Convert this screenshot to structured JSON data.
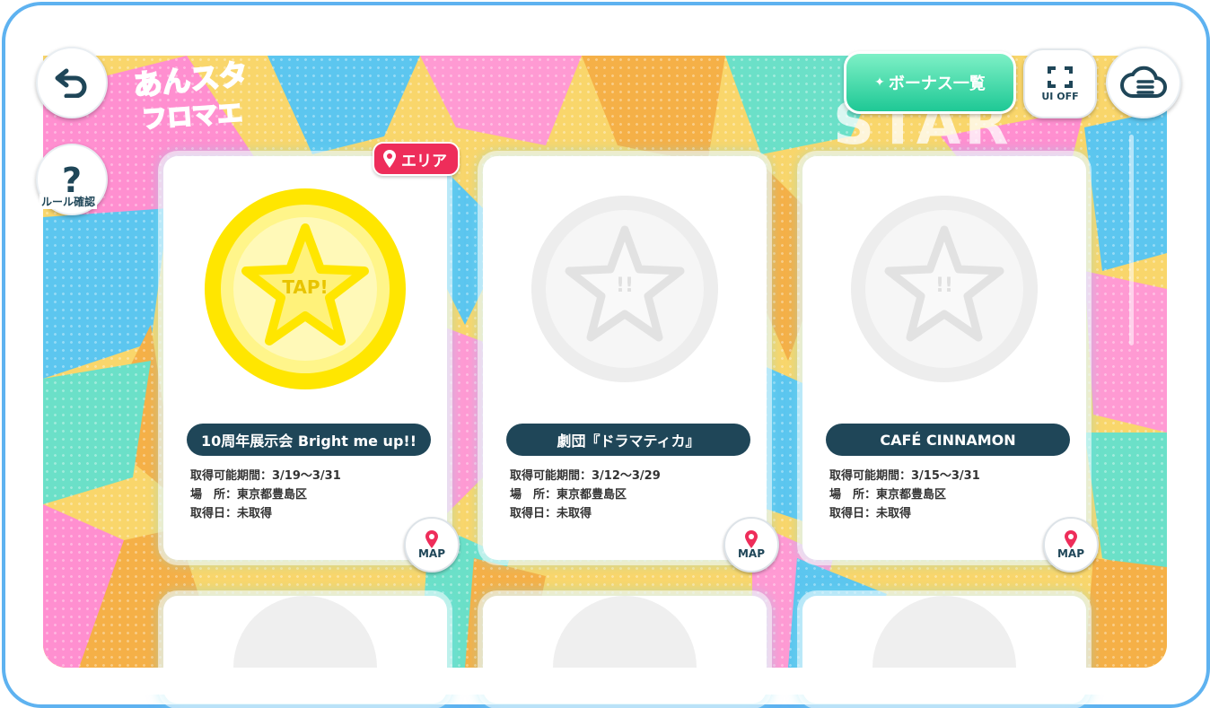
{
  "header": {
    "logo_text_line1": "あんスタ",
    "logo_text_line2": "フロマエ",
    "bonus_button_label": "ボーナス一覧",
    "ui_off_label": "UI OFF",
    "help_label": "ルール確認"
  },
  "background": {
    "word": "STAR"
  },
  "cards": [
    {
      "title": "10周年展示会 Bright me up!!",
      "period": "取得可能期間：3/19〜3/31",
      "place": "場　所：東京都豊島区",
      "acquired": "取得日：未取得",
      "badge": "エリア",
      "medal_text": "TAP!",
      "active": true,
      "map_label": "MAP"
    },
    {
      "title": "劇団『ドラマティカ』",
      "period": "取得可能期間：3/12〜3/29",
      "place": "場　所：東京都豊島区",
      "acquired": "取得日：未取得",
      "medal_text": "!!",
      "active": false,
      "map_label": "MAP"
    },
    {
      "title": "CAFÉ CINNAMON",
      "period": "取得可能期間：3/15〜3/31",
      "place": "場　所：東京都豊島区",
      "acquired": "取得日：未取得",
      "medal_text": "!!",
      "active": false,
      "map_label": "MAP"
    }
  ],
  "colors": {
    "frame": "#5eb2f0",
    "pill": "#1f4658",
    "badge": "#ee2d5a",
    "bonus": "#1ec895",
    "medal_active": "#ffe600",
    "medal_inactive": "#e4e4e4"
  },
  "icons": [
    "back-arrow-icon",
    "question-icon",
    "fullscreen-icon",
    "cloud-menu-icon",
    "map-pin-icon",
    "star-icon"
  ]
}
